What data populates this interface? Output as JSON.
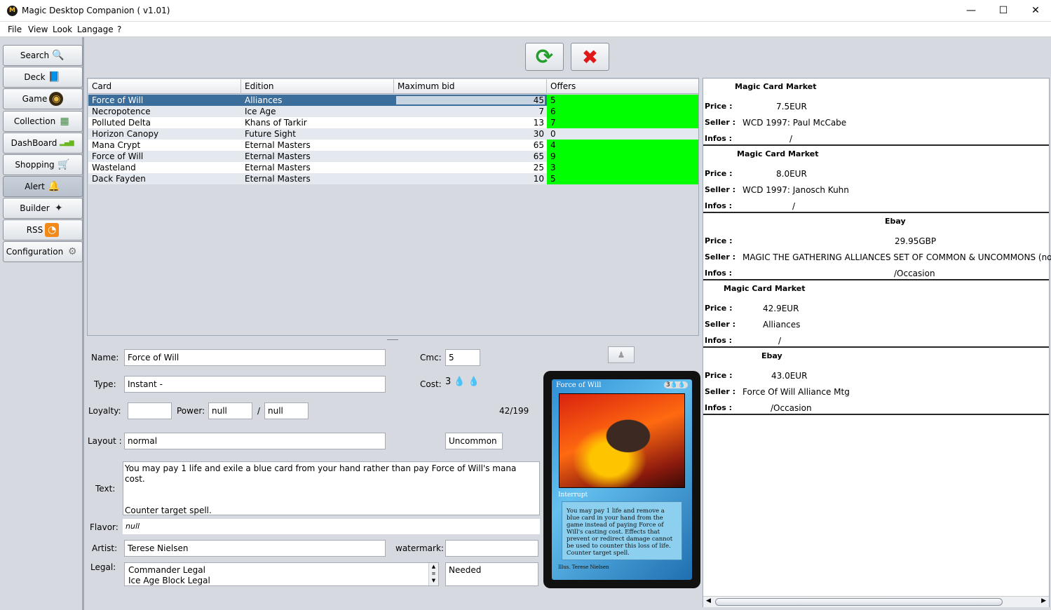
{
  "window": {
    "title": "Magic Desktop Companion ( v1.01)",
    "app_logo_letter": "M",
    "min": "—",
    "max": "☐",
    "close": "✕"
  },
  "menu": [
    "File",
    "View",
    "Look",
    "Langage",
    "?"
  ],
  "nav": [
    {
      "label": "Search",
      "icon": "search-icon",
      "glyph": "🔍"
    },
    {
      "label": "Deck",
      "icon": "book-icon",
      "glyph": "📘"
    },
    {
      "label": "Game",
      "icon": "game-icon",
      "glyph": "◉"
    },
    {
      "label": "Collection",
      "icon": "collection-icon",
      "glyph": "▦"
    },
    {
      "label": "DashBoard",
      "icon": "dashboard-icon",
      "glyph": "▂▄▆"
    },
    {
      "label": "Shopping",
      "icon": "cart-icon",
      "glyph": "🛒"
    },
    {
      "label": "Alert",
      "icon": "bell-icon",
      "glyph": "🔔"
    },
    {
      "label": "Builder",
      "icon": "wand-icon",
      "glyph": "✦"
    },
    {
      "label": "RSS",
      "icon": "rss-icon",
      "glyph": "◔"
    },
    {
      "label": "Configuration",
      "icon": "gear-icon",
      "glyph": "⚙"
    }
  ],
  "toolbar": {
    "refresh": "⟳",
    "delete": "✖"
  },
  "table": {
    "headers": [
      "Card",
      "Edition",
      "Maximum bid",
      "Offers"
    ],
    "rows": [
      {
        "card": "Force of Will",
        "edition": "Alliances",
        "bid": "45",
        "offers": "5",
        "green": true
      },
      {
        "card": "Necropotence",
        "edition": "Ice Age",
        "bid": "7",
        "offers": "6",
        "green": true
      },
      {
        "card": "Polluted Delta",
        "edition": "Khans of Tarkir",
        "bid": "13",
        "offers": "7",
        "green": true
      },
      {
        "card": "Horizon Canopy",
        "edition": "Future Sight",
        "bid": "30",
        "offers": "0",
        "green": false
      },
      {
        "card": "Mana Crypt",
        "edition": "Eternal Masters",
        "bid": "65",
        "offers": "4",
        "green": true
      },
      {
        "card": "Force of Will",
        "edition": "Eternal Masters",
        "bid": "65",
        "offers": "9",
        "green": true
      },
      {
        "card": "Wasteland",
        "edition": "Eternal Masters",
        "bid": "25",
        "offers": "3",
        "green": true
      },
      {
        "card": "Dack Fayden",
        "edition": "Eternal Masters",
        "bid": "10",
        "offers": "5",
        "green": true
      }
    ],
    "offers_green_color": "#00ff00",
    "selected_color": "#3b6e9a"
  },
  "detail": {
    "name_label": "Name:",
    "name": "Force of Will",
    "cmc_label": "Cmc:",
    "cmc": "5",
    "type_label": "Type:",
    "type": "Instant  -",
    "cost_label": "Cost:",
    "cost_glyphs": "3 💧 💧",
    "loyalty_label": "Loyalty:",
    "loyalty": "",
    "power_label": "Power:",
    "power": "null",
    "slash": "/",
    "toughness": "null",
    "number": "42/199",
    "layout_label": "Layout :",
    "layout": "normal",
    "rarity": "Uncommon",
    "text_label": "Text:",
    "text_line1": "You may pay 1 life and exile a blue card from your hand rather than pay Force of Will's mana cost.",
    "text_line2": "Counter target spell.",
    "flavor_label": "Flavor:",
    "flavor": "null",
    "artist_label": "Artist:",
    "artist": "Terese Nielsen",
    "watermark_label": "watermark:",
    "watermark": "",
    "legal_label": "Legal:",
    "legal_1": "Commander Legal",
    "legal_2": "Ice Age Block Legal",
    "needed": "Needed"
  },
  "card_image": {
    "title": "Force of Will",
    "mana": "3💧💧",
    "type_line": "Interrupt",
    "rules": "You may pay 1 life and remove a blue card in your hand from the game instead of paying Force of Will's casting cost. Effects that prevent or redirect damage cannot be used to counter this loss of life. Counter target spell.",
    "artist": "Illus. Terese Nielsen"
  },
  "offers": [
    {
      "source": "Magic Card Market",
      "price": "7.5EUR",
      "seller": "WCD 1997: Paul McCabe",
      "infos": "/"
    },
    {
      "source": "Magic Card Market",
      "price": "8.0EUR",
      "seller": "WCD 1997: Janosch Kuhn",
      "infos": "/"
    },
    {
      "source": "Ebay",
      "price": "29.95GBP",
      "seller": "MAGIC THE GATHERING ALLIANCES SET OF COMMON & UNCOMMONS (no fo",
      "infos": "/Occasion"
    },
    {
      "source": "Magic Card Market",
      "price": "42.9EUR",
      "seller": "Alliances",
      "infos": "/"
    },
    {
      "source": "Ebay",
      "price": "43.0EUR",
      "seller": "Force Of Will Alliance Mtg",
      "infos": "/Occasion"
    }
  ],
  "offer_labels": {
    "price": "Price :",
    "seller": "Seller :",
    "infos": "Infos :"
  }
}
